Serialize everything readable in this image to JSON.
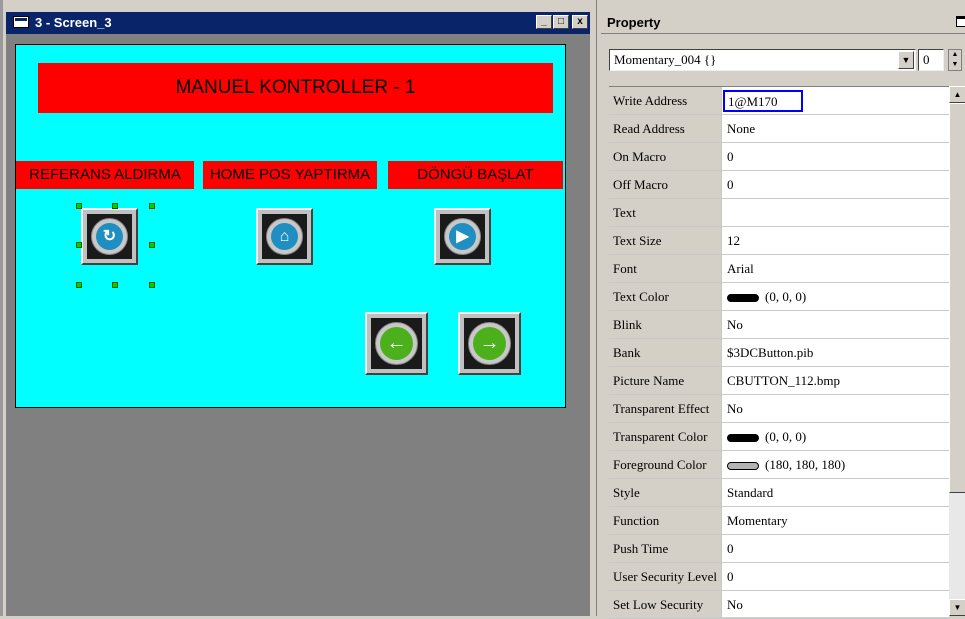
{
  "screen_window": {
    "title": "3 - Screen_3",
    "controls": {
      "minimize": "_",
      "maximize": "□",
      "close": "x"
    }
  },
  "hmi": {
    "title": "MANUEL KONTROLLER - 1",
    "labels": [
      "REFERANS ALDIRMA",
      "HOME POS YAPTIRMA",
      "DÖNGÜ BAŞLAT"
    ],
    "buttons": [
      {
        "name": "reference",
        "icon": "reset-icon",
        "glyph": "↻"
      },
      {
        "name": "home",
        "icon": "home-icon",
        "glyph": "⌂"
      },
      {
        "name": "play",
        "icon": "play-icon",
        "glyph": "▶"
      },
      {
        "name": "back",
        "icon": "arrow-left-icon",
        "glyph": "←"
      },
      {
        "name": "forward",
        "icon": "arrow-right-icon",
        "glyph": "→"
      }
    ]
  },
  "property_panel": {
    "header": "Property",
    "object_select": "Momentary_004 {}",
    "layer_value": "0",
    "rows": [
      {
        "name": "Write Address",
        "value": "1@M170",
        "highlighted": true
      },
      {
        "name": "Read Address",
        "value": "None"
      },
      {
        "name": "On Macro",
        "value": "0"
      },
      {
        "name": "Off Macro",
        "value": "0"
      },
      {
        "name": "Text",
        "value": ""
      },
      {
        "name": "Text Size",
        "value": "12"
      },
      {
        "name": "Font",
        "value": "Arial"
      },
      {
        "name": "Text Color",
        "value": "(0, 0, 0)",
        "swatch": "#000000"
      },
      {
        "name": "Blink",
        "value": "No"
      },
      {
        "name": "Bank",
        "value": "$3DCButton.pib"
      },
      {
        "name": "Picture Name",
        "value": "CBUTTON_112.bmp"
      },
      {
        "name": "Transparent Effect",
        "value": "No"
      },
      {
        "name": "Transparent Color",
        "value": "(0, 0, 0)",
        "swatch": "#000000"
      },
      {
        "name": "Foreground Color",
        "value": "(180, 180, 180)",
        "swatch": "#b4b4b4"
      },
      {
        "name": "Style",
        "value": "Standard"
      },
      {
        "name": "Function",
        "value": "Momentary"
      },
      {
        "name": "Push Time",
        "value": "0"
      },
      {
        "name": "User Security Level",
        "value": "0"
      },
      {
        "name": "Set Low Security",
        "value": "No"
      }
    ]
  },
  "colors": {
    "canvas": "#00ffff",
    "label": "#ff0000",
    "titlebar": "#0a246a",
    "highlight_border": "#0000ff"
  }
}
